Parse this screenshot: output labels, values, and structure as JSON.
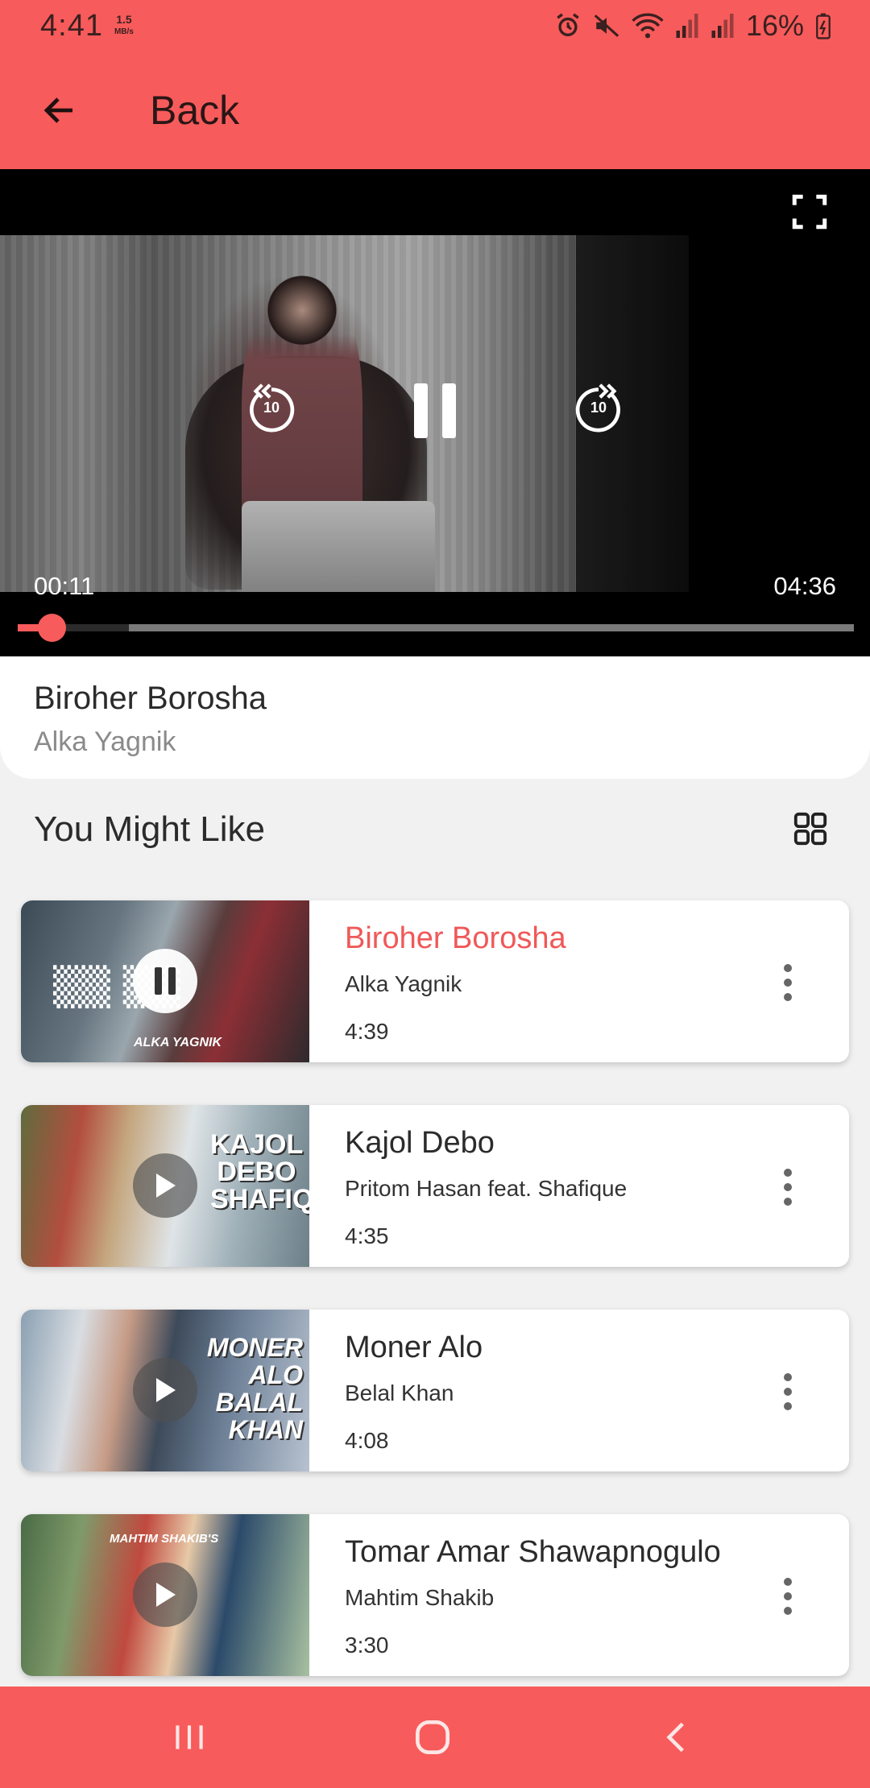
{
  "status_bar": {
    "time": "4:41",
    "speed_value": "1.5",
    "speed_unit": "MB/s",
    "battery": "16%"
  },
  "app_bar": {
    "title": "Back"
  },
  "player": {
    "current_time": "00:11",
    "total_time": "04:36",
    "progress_fraction": 0.04,
    "rewind_seconds": "10",
    "forward_seconds": "10"
  },
  "now_playing": {
    "title": "Biroher Borosha",
    "artist": "Alka Yagnik"
  },
  "section": {
    "title": "You Might Like"
  },
  "songs": [
    {
      "title": "Biroher Borosha",
      "artist": "Alka Yagnik",
      "duration": "4:39",
      "active": true,
      "thumb_text": "ALKA YAGNIK"
    },
    {
      "title": "Kajol Debo",
      "artist": "Pritom Hasan feat. Shafique",
      "duration": "4:35",
      "active": false,
      "thumb_text": "KAJOL DEBO SHAFIQUE"
    },
    {
      "title": "Moner Alo",
      "artist": "Belal Khan",
      "duration": "4:08",
      "active": false,
      "thumb_text": "MONER ALO BALAL KHAN"
    },
    {
      "title": "Tomar Amar Shawapnogulo",
      "artist": "Mahtim Shakib",
      "duration": "3:30",
      "active": false,
      "thumb_text": "MAHTIM SHAKIB'S"
    }
  ],
  "colors": {
    "accent": "#f85b5b",
    "active_title": "#f05858"
  }
}
